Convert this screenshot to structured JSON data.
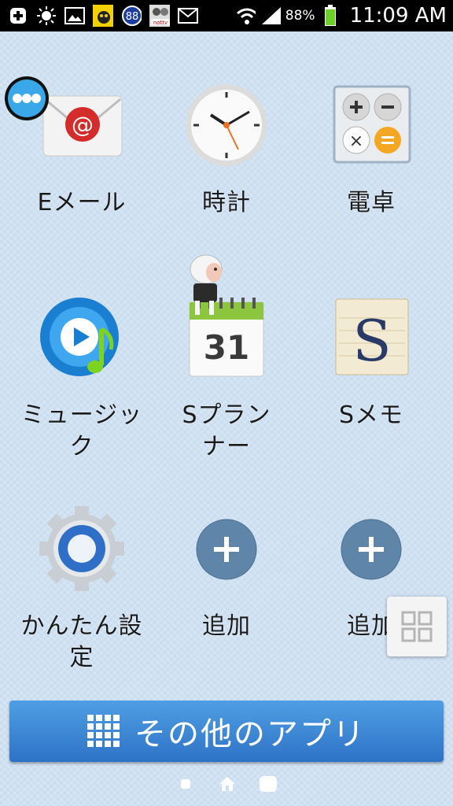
{
  "status_bar": {
    "battery_percent": "88%",
    "time": "11:09 AM",
    "icons": [
      "add-icon",
      "brightness-icon",
      "gallery-icon",
      "pikachu-app-icon",
      "badge-88-icon",
      "nottv-icon",
      "gmail-icon",
      "wifi-icon",
      "signal-icon",
      "battery-icon"
    ],
    "badge_text": "88"
  },
  "apps": [
    {
      "id": "email",
      "label": "Eメール",
      "icon": "email-icon"
    },
    {
      "id": "clock",
      "label": "時計",
      "icon": "clock-icon"
    },
    {
      "id": "calculator",
      "label": "電卓",
      "icon": "calculator-icon"
    },
    {
      "id": "music",
      "label": "ミュージック",
      "label_line1": "ミュージッ",
      "label_line2": "ク",
      "icon": "music-icon"
    },
    {
      "id": "splanner",
      "label": "Sプランナー",
      "label_line1": "Sプラン",
      "label_line2": "ナー",
      "icon": "calendar-icon",
      "calendar_day": "31"
    },
    {
      "id": "smemo",
      "label": "Sメモ",
      "icon": "smemo-icon",
      "icon_letter": "S"
    },
    {
      "id": "easy-settings",
      "label": "かんたん設定",
      "label_line1": "かんたん設",
      "label_line2": "定",
      "icon": "settings-gear-icon"
    },
    {
      "id": "add1",
      "label": "追加",
      "icon": "add-circle-icon"
    },
    {
      "id": "add2",
      "label": "追加",
      "icon": "add-circle-icon"
    }
  ],
  "bottom": {
    "all_apps_label": "その他のアプリ",
    "all_apps_icon": "grid-icon"
  },
  "colors": {
    "background": "#cfe1f2",
    "all_apps_button": "#3b86d6",
    "add_circle": "#5f86a8"
  }
}
